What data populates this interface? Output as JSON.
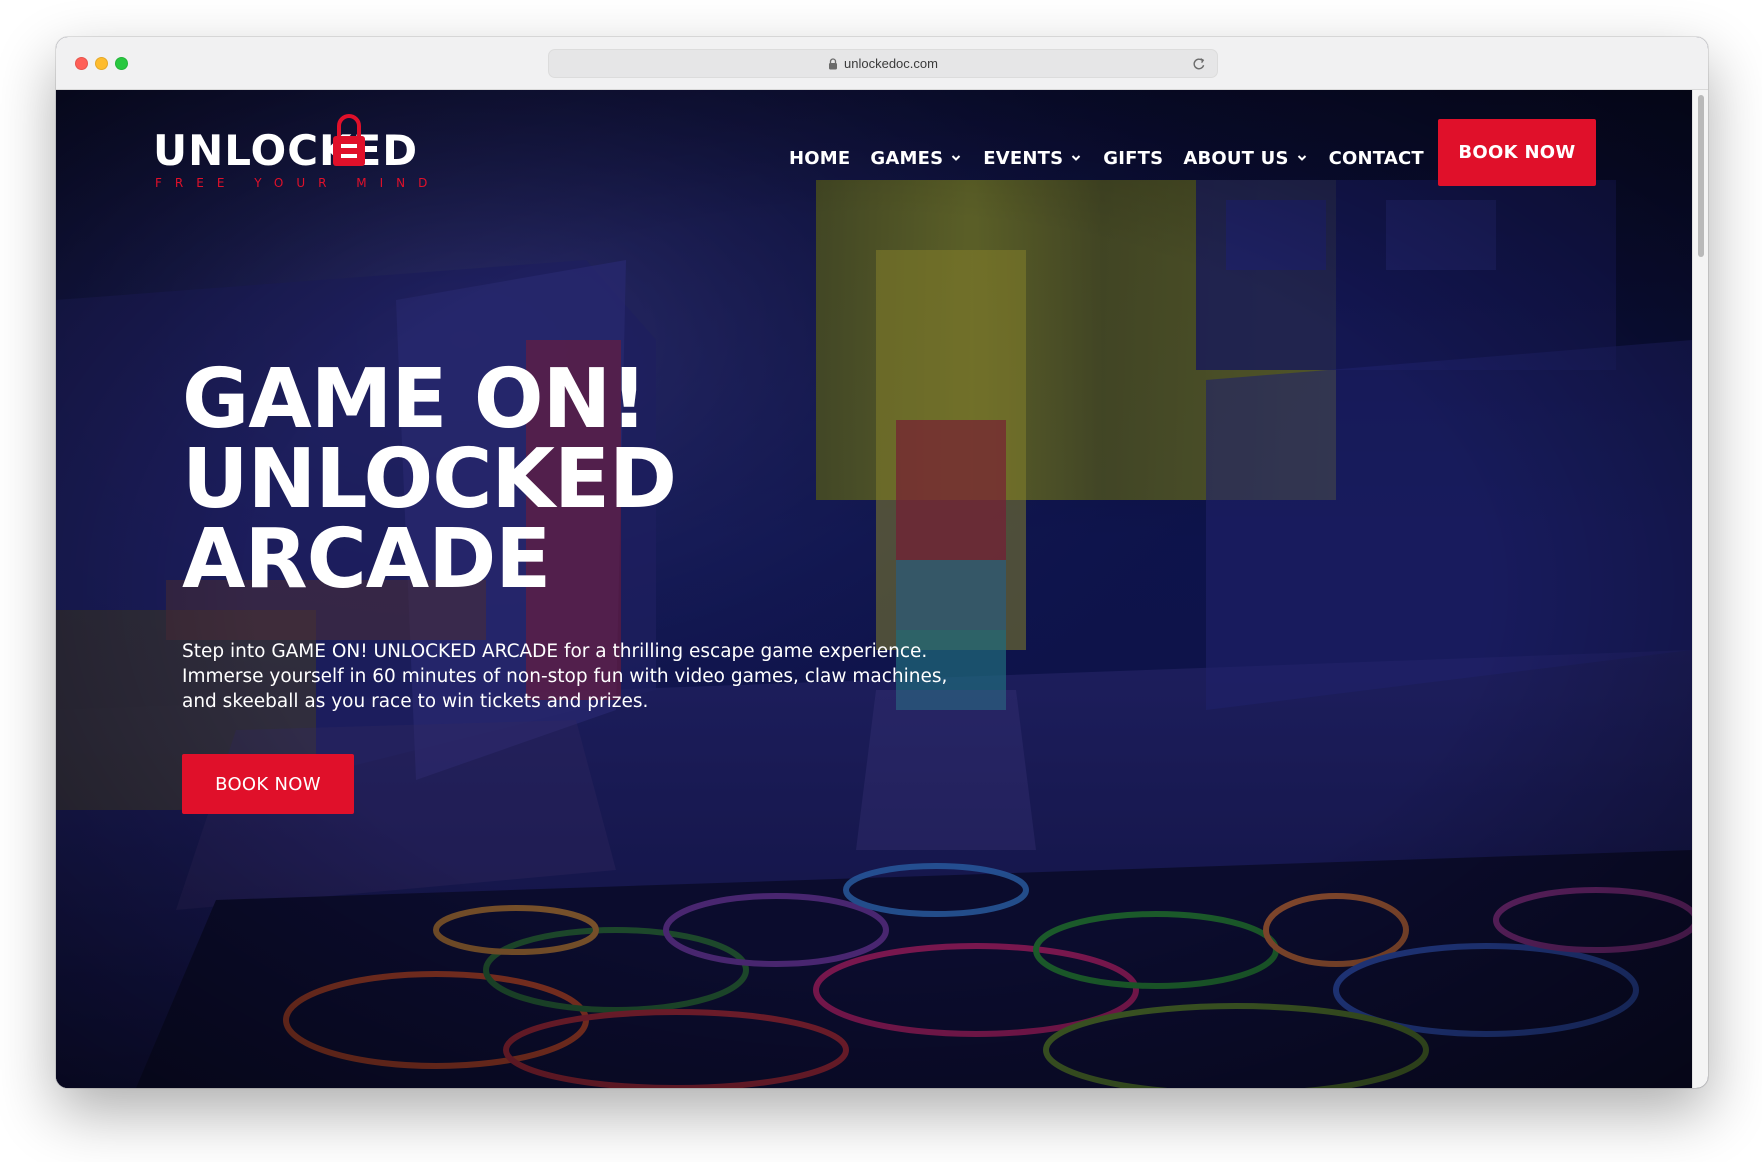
{
  "browser": {
    "url": "unlockedoc.com"
  },
  "site": {
    "logo_word": "UNLOCKED",
    "logo_tagline": "FREE YOUR MIND"
  },
  "nav": {
    "items": [
      {
        "label": "HOME",
        "has_dropdown": false
      },
      {
        "label": "GAMES",
        "has_dropdown": true
      },
      {
        "label": "EVENTS",
        "has_dropdown": true
      },
      {
        "label": "GIFTS",
        "has_dropdown": false
      },
      {
        "label": "ABOUT US",
        "has_dropdown": true
      },
      {
        "label": "CONTACT",
        "has_dropdown": false
      }
    ],
    "cta_label": "BOOK NOW"
  },
  "hero": {
    "title_lines": [
      "GAME ON!",
      "UNLOCKED",
      "ARCADE"
    ],
    "description_lines": [
      "Step into GAME ON! UNLOCKED ARCADE for a thrilling escape game experience.",
      "Immerse yourself in 60 minutes of non-stop fun with video games, claw machines,",
      "and skeeball as you race to win tickets and prizes."
    ],
    "cta_label": "BOOK NOW"
  },
  "colors": {
    "accent": "#e0102a",
    "hero_overlay": "#0d0f3a",
    "text": "#ffffff"
  },
  "icons": {
    "lock": "lock-icon",
    "reload": "reload-icon",
    "dropdown": "chevron-down-icon"
  }
}
